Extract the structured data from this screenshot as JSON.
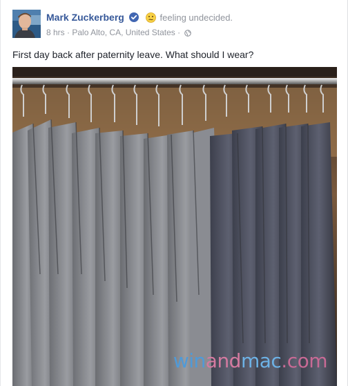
{
  "post": {
    "author": "Mark Zuckerberg",
    "feeling": "feeling undecided.",
    "time": "8 hrs",
    "location": "Palo Alto, CA, United States",
    "separator": "·",
    "text": "First day back after paternity leave. What should I wear?"
  },
  "photo": {
    "watermark_win": "win",
    "watermark_and": "and",
    "watermark_mac": "mac",
    "watermark_com": ".com"
  },
  "icons": {
    "verified": "verified-badge-icon",
    "feeling": "undecided-emoji-icon",
    "audience": "globe-icon"
  },
  "colors": {
    "author": "#365899",
    "meta": "#90949c",
    "verified": "#4267b2"
  }
}
